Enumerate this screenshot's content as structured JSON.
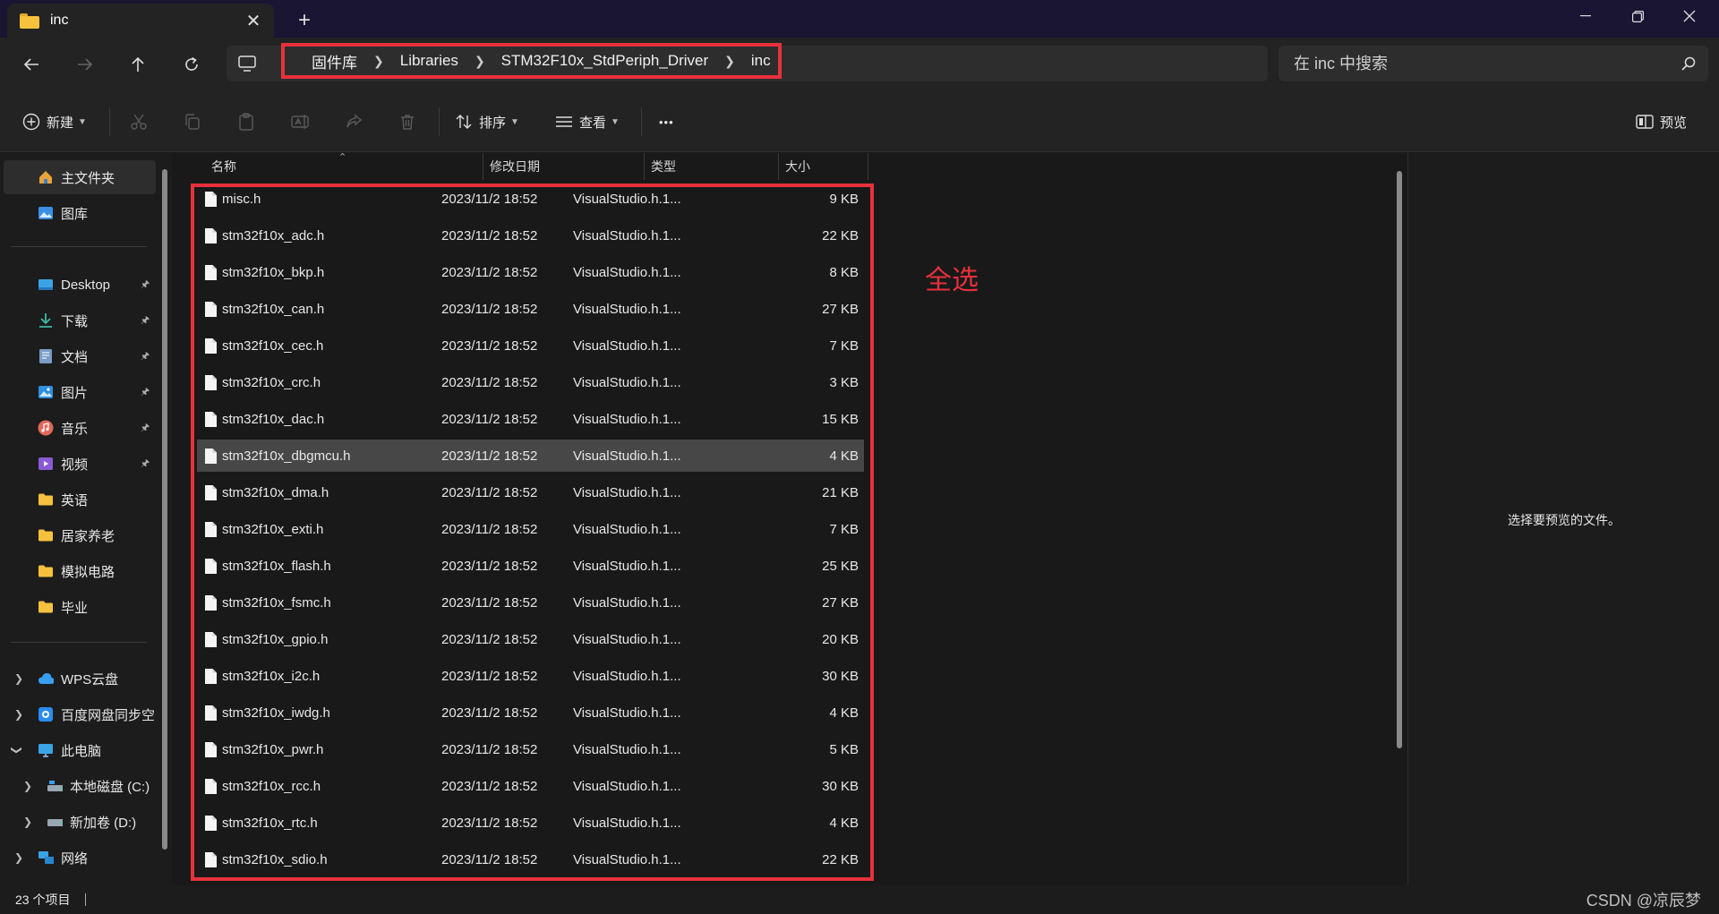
{
  "window": {
    "tab_title": "inc",
    "close_tab": "✕",
    "new_tab": "+"
  },
  "address": {
    "crumbs": [
      "固件库",
      "Libraries",
      "STM32F10x_StdPeriph_Driver",
      "inc"
    ],
    "search_placeholder": "在 inc 中搜索"
  },
  "toolbar": {
    "new_label": "新建",
    "sort_label": "排序",
    "view_label": "查看",
    "more_label": "•••",
    "preview_label": "预览"
  },
  "sidebar": {
    "items": [
      {
        "label": "主文件夹",
        "icon": "home-icon"
      },
      {
        "label": "图库",
        "icon": "gallery-icon"
      },
      {
        "label": "Desktop",
        "icon": "desktop-icon"
      },
      {
        "label": "下载",
        "icon": "download-icon"
      },
      {
        "label": "文档",
        "icon": "documents-icon"
      },
      {
        "label": "图片",
        "icon": "pictures-icon"
      },
      {
        "label": "音乐",
        "icon": "music-icon"
      },
      {
        "label": "视频",
        "icon": "videos-icon"
      },
      {
        "label": "英语",
        "icon": "folder-icon"
      },
      {
        "label": "居家养老",
        "icon": "folder-icon"
      },
      {
        "label": "模拟电路",
        "icon": "folder-icon"
      },
      {
        "label": "毕业",
        "icon": "folder-icon"
      },
      {
        "label": "WPS云盘",
        "icon": "cloud-icon"
      },
      {
        "label": "百度网盘同步空",
        "icon": "baidu-sync-icon"
      },
      {
        "label": "此电脑",
        "icon": "this-pc-icon"
      },
      {
        "label": "本地磁盘 (C:)",
        "icon": "drive-icon"
      },
      {
        "label": "新加卷 (D:)",
        "icon": "drive-icon"
      },
      {
        "label": "网络",
        "icon": "network-icon"
      }
    ]
  },
  "columns": {
    "name": "名称",
    "modified": "修改日期",
    "type": "类型",
    "size": "大小"
  },
  "files": [
    {
      "name": "misc.h",
      "date": "2023/11/2 18:52",
      "type": "VisualStudio.h.1...",
      "size": "9 KB"
    },
    {
      "name": "stm32f10x_adc.h",
      "date": "2023/11/2 18:52",
      "type": "VisualStudio.h.1...",
      "size": "22 KB"
    },
    {
      "name": "stm32f10x_bkp.h",
      "date": "2023/11/2 18:52",
      "type": "VisualStudio.h.1...",
      "size": "8 KB"
    },
    {
      "name": "stm32f10x_can.h",
      "date": "2023/11/2 18:52",
      "type": "VisualStudio.h.1...",
      "size": "27 KB"
    },
    {
      "name": "stm32f10x_cec.h",
      "date": "2023/11/2 18:52",
      "type": "VisualStudio.h.1...",
      "size": "7 KB"
    },
    {
      "name": "stm32f10x_crc.h",
      "date": "2023/11/2 18:52",
      "type": "VisualStudio.h.1...",
      "size": "3 KB"
    },
    {
      "name": "stm32f10x_dac.h",
      "date": "2023/11/2 18:52",
      "type": "VisualStudio.h.1...",
      "size": "15 KB"
    },
    {
      "name": "stm32f10x_dbgmcu.h",
      "date": "2023/11/2 18:52",
      "type": "VisualStudio.h.1...",
      "size": "4 KB"
    },
    {
      "name": "stm32f10x_dma.h",
      "date": "2023/11/2 18:52",
      "type": "VisualStudio.h.1...",
      "size": "21 KB"
    },
    {
      "name": "stm32f10x_exti.h",
      "date": "2023/11/2 18:52",
      "type": "VisualStudio.h.1...",
      "size": "7 KB"
    },
    {
      "name": "stm32f10x_flash.h",
      "date": "2023/11/2 18:52",
      "type": "VisualStudio.h.1...",
      "size": "25 KB"
    },
    {
      "name": "stm32f10x_fsmc.h",
      "date": "2023/11/2 18:52",
      "type": "VisualStudio.h.1...",
      "size": "27 KB"
    },
    {
      "name": "stm32f10x_gpio.h",
      "date": "2023/11/2 18:52",
      "type": "VisualStudio.h.1...",
      "size": "20 KB"
    },
    {
      "name": "stm32f10x_i2c.h",
      "date": "2023/11/2 18:52",
      "type": "VisualStudio.h.1...",
      "size": "30 KB"
    },
    {
      "name": "stm32f10x_iwdg.h",
      "date": "2023/11/2 18:52",
      "type": "VisualStudio.h.1...",
      "size": "4 KB"
    },
    {
      "name": "stm32f10x_pwr.h",
      "date": "2023/11/2 18:52",
      "type": "VisualStudio.h.1...",
      "size": "5 KB"
    },
    {
      "name": "stm32f10x_rcc.h",
      "date": "2023/11/2 18:52",
      "type": "VisualStudio.h.1...",
      "size": "30 KB"
    },
    {
      "name": "stm32f10x_rtc.h",
      "date": "2023/11/2 18:52",
      "type": "VisualStudio.h.1...",
      "size": "4 KB"
    },
    {
      "name": "stm32f10x_sdio.h",
      "date": "2023/11/2 18:52",
      "type": "VisualStudio.h.1...",
      "size": "22 KB"
    }
  ],
  "annotation": "全选",
  "preview": {
    "empty_text": "选择要预览的文件。"
  },
  "status": {
    "item_count": "23 个项目",
    "watermark": "CSDN @凉辰梦"
  },
  "colors": {
    "highlight_red": "#e8313c",
    "folder_yellow": "#f6c13d",
    "titlebar": "#1a1533"
  }
}
